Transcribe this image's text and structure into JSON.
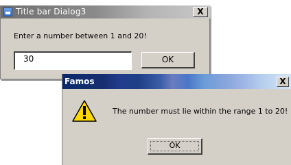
{
  "dialog_input": {
    "title": "Title bar Dialog3",
    "close_label": "X",
    "prompt": "Enter a number between 1 and 20!",
    "input_value": "30",
    "ok_label": "OK"
  },
  "dialog_error": {
    "title": "Famos",
    "close_label": "X",
    "icon": "warning-icon",
    "message": "The number must lie within the range 1 to 20!",
    "ok_label": "OK"
  },
  "colors": {
    "dialog_face": "#d4d0c8",
    "warning_yellow": "#ffd800"
  }
}
